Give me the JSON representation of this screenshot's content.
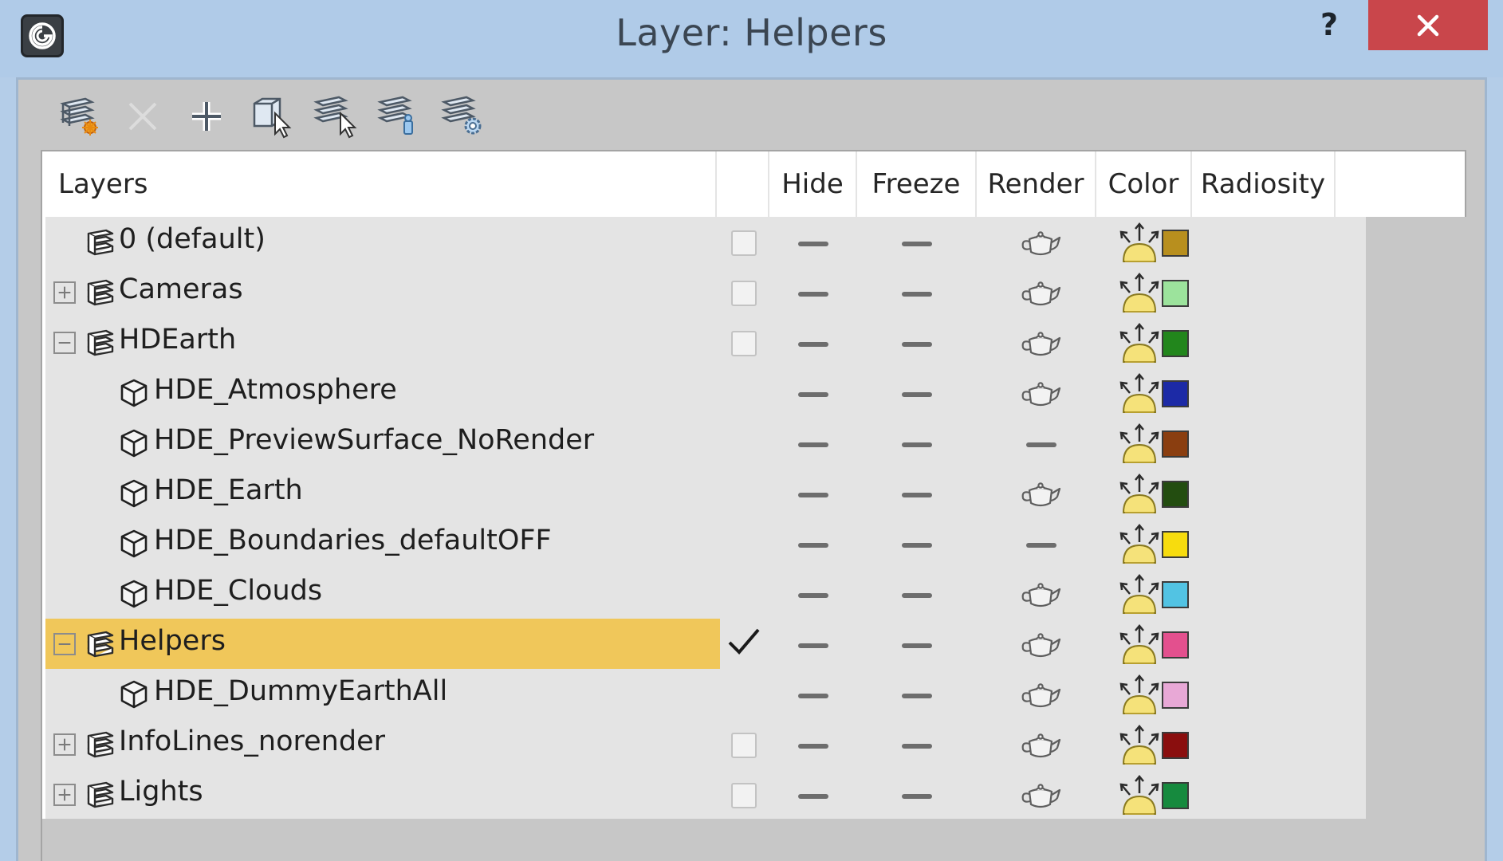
{
  "window": {
    "title": "Layer: Helpers",
    "help_label": "?"
  },
  "toolbar": {
    "buttons": [
      {
        "icon": "create-layer-icon",
        "enabled": true
      },
      {
        "icon": "delete-layer-icon",
        "enabled": false
      },
      {
        "icon": "add-to-layer-icon",
        "enabled": true
      },
      {
        "icon": "select-objects-icon",
        "enabled": true
      },
      {
        "icon": "select-layer-icon",
        "enabled": true
      },
      {
        "icon": "set-current-layer-icon",
        "enabled": true
      },
      {
        "icon": "layer-properties-icon",
        "enabled": true
      }
    ]
  },
  "columns": {
    "layers": "Layers",
    "hide": "Hide",
    "freeze": "Freeze",
    "render": "Render",
    "color": "Color",
    "radiosity": "Radiosity"
  },
  "rows": [
    {
      "name": "0 (default)",
      "kind": "layer",
      "expander": "none",
      "active": false,
      "render": true,
      "color": "#b88f1e"
    },
    {
      "name": "Cameras",
      "kind": "layer",
      "expander": "plus",
      "active": false,
      "render": true,
      "color": "#9ce39c"
    },
    {
      "name": "HDEarth",
      "kind": "layer",
      "expander": "minus",
      "active": false,
      "render": true,
      "color": "#22861c"
    },
    {
      "name": "HDE_Atmosphere",
      "kind": "object",
      "expander": "none",
      "active": null,
      "render": true,
      "color": "#1c2aa6"
    },
    {
      "name": "HDE_PreviewSurface_NoRender",
      "kind": "object",
      "expander": "none",
      "active": null,
      "render": false,
      "color": "#8a3e10"
    },
    {
      "name": "HDE_Earth",
      "kind": "object",
      "expander": "none",
      "active": null,
      "render": true,
      "color": "#234d10"
    },
    {
      "name": "HDE_Boundaries_defaultOFF",
      "kind": "object",
      "expander": "none",
      "active": null,
      "render": false,
      "color": "#f7dc0e"
    },
    {
      "name": "HDE_Clouds",
      "kind": "object",
      "expander": "none",
      "active": null,
      "render": true,
      "color": "#52c3e3"
    },
    {
      "name": "Helpers",
      "kind": "layer",
      "expander": "minus",
      "active": true,
      "render": true,
      "color": "#e3508e",
      "selected": true
    },
    {
      "name": "HDE_DummyEarthAll",
      "kind": "object",
      "expander": "none",
      "active": null,
      "render": true,
      "color": "#e8a8d6"
    },
    {
      "name": "InfoLines_norender",
      "kind": "layer",
      "expander": "plus",
      "active": false,
      "render": true,
      "color": "#8a0e0e"
    },
    {
      "name": "Lights",
      "kind": "layer",
      "expander": "plus",
      "active": false,
      "render": true,
      "color": "#168a3e"
    }
  ]
}
